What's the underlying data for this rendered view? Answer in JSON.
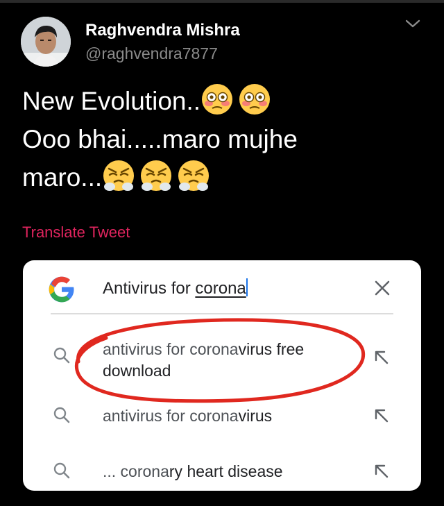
{
  "tweet": {
    "author_name": "Raghvendra Mishra",
    "author_handle": "@raghvendra7877",
    "line1": "New Evolution..",
    "line2": "Ooo bhai.....maro mujhe",
    "line3": "maro...",
    "translate_label": "Translate Tweet",
    "emojis_line1": "flushed-face",
    "emojis_line3": "face-with-steam-from-nose"
  },
  "search_card": {
    "query_prefix": "Antivirus for ",
    "query_typed": "corona",
    "suggestions": [
      {
        "prefix": "antivirus for corona",
        "completion": "virus free download"
      },
      {
        "prefix": "antivirus for corona",
        "completion": "virus"
      },
      {
        "prefix": "... corona",
        "completion": "ry heart disease"
      }
    ]
  },
  "colors": {
    "background": "#000000",
    "translate_link": "#e0245e",
    "annotation_circle": "#e0281f",
    "google_blue": "#4285F4",
    "google_red": "#EA4335",
    "google_yellow": "#FBBC05",
    "google_green": "#34A853"
  }
}
